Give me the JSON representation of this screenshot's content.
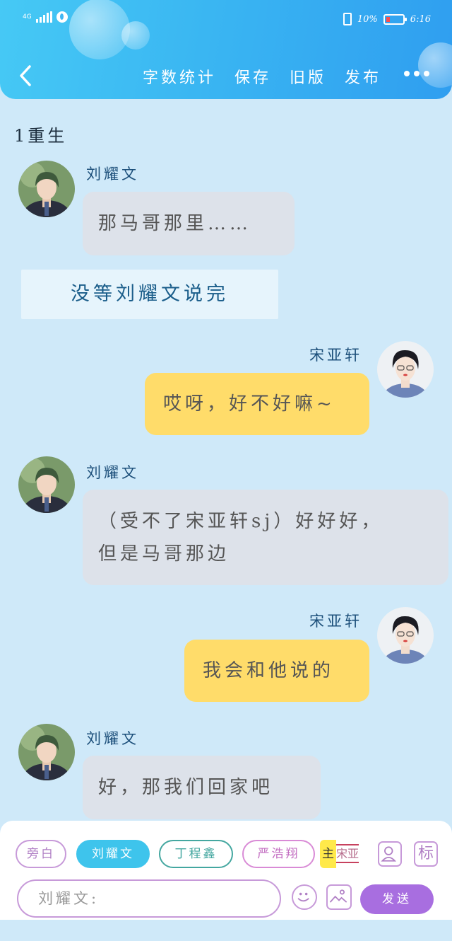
{
  "status": {
    "network": "4G",
    "battery": "10%",
    "time": "6:16"
  },
  "nav": {
    "items": [
      "字数统计",
      "保存",
      "旧版",
      "发布"
    ]
  },
  "chat": {
    "section_title": "1重生",
    "messages": [
      {
        "type": "left",
        "name": "刘耀文",
        "lines": [
          "那马哥那里……"
        ]
      },
      {
        "type": "narration",
        "text": "没等刘耀文说完"
      },
      {
        "type": "right",
        "name": "宋亚轩",
        "lines": [
          "哎呀，好不好嘛~"
        ]
      },
      {
        "type": "left",
        "name": "刘耀文",
        "lines": [
          "（受不了宋亚轩sj）好好好，",
          "但是马哥那边"
        ]
      },
      {
        "type": "right",
        "name": "宋亚轩",
        "lines": [
          "我会和他说的"
        ]
      },
      {
        "type": "left",
        "name": "刘耀文",
        "lines": [
          "好，那我们回家吧"
        ]
      }
    ]
  },
  "composer": {
    "chips": [
      {
        "label": "旁白",
        "style": "narr"
      },
      {
        "label": "刘耀文",
        "style": "active"
      },
      {
        "label": "丁程鑫",
        "style": "teal"
      },
      {
        "label": "严浩翔",
        "style": "pink"
      }
    ],
    "main_flag": "主",
    "main_name": "宋亚",
    "mark_button": "标",
    "input_placeholder": "刘耀文:",
    "send_label": "发送"
  },
  "colors": {
    "header_accent": "#3ab6f2",
    "left_bubble": "#dde2ea",
    "right_bubble": "#ffdc6a",
    "send_button": "#a86ee0",
    "chip_border": "#c79ad9"
  }
}
